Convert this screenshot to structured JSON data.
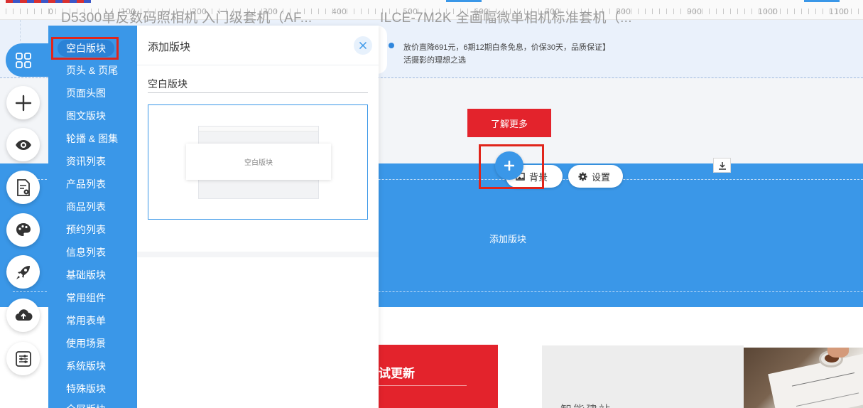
{
  "window": {
    "title_1": "D5300单反数码照相机 入门级套机（AF...",
    "title_2": "ILCE-7M2K 全画幅微单相机标准套机（..."
  },
  "ruler": {
    "labels": [
      "0",
      "100",
      "200",
      "300",
      "400",
      "500",
      "600",
      "700",
      "800",
      "900",
      "1000",
      "1100"
    ]
  },
  "toolbar": {
    "items": [
      {
        "name": "blocks",
        "icon": "grid-icon",
        "active": true
      },
      {
        "name": "add",
        "icon": "plus-icon"
      },
      {
        "name": "preview",
        "icon": "eye-icon"
      },
      {
        "name": "page-settings",
        "icon": "document-gear-icon"
      },
      {
        "name": "theme",
        "icon": "palette-icon"
      },
      {
        "name": "publish",
        "icon": "rocket-icon"
      },
      {
        "name": "upload",
        "icon": "cloud-upload-icon"
      },
      {
        "name": "settings",
        "icon": "sliders-icon"
      }
    ]
  },
  "categories": {
    "items": [
      "空白版块",
      "页头 & 页尾",
      "页面头图",
      "图文版块",
      "轮播 & 图集",
      "资讯列表",
      "产品列表",
      "商品列表",
      "预约列表",
      "信息列表",
      "基础版块",
      "常用组件",
      "常用表单",
      "使用场景",
      "系统版块",
      "特殊版块",
      "全屏版块"
    ],
    "selected_index": 0
  },
  "panel": {
    "title": "添加版块",
    "section_title": "空白版块",
    "thumbnail_label": "空白版块"
  },
  "canvas": {
    "notice_line_1": "放价直降691元，6期12期白条免息，价保30天，品质保证】",
    "notice_line_2": "活摄影的理想之选",
    "learn_more": "了解更多",
    "background_button": "背景",
    "settings_button": "设置",
    "add_block_text": "添加版块",
    "red_card_title": "试更新",
    "grey_card_title": "智能建站"
  },
  "colors": {
    "primary": "#3a97e8",
    "accent_red": "#e3232c",
    "highlight_red": "#e0251b"
  }
}
